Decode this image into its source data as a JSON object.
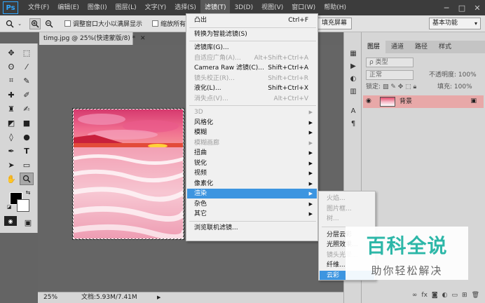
{
  "app": {
    "logo": "Ps"
  },
  "menubar": {
    "items": [
      "文件(F)",
      "编辑(E)",
      "图像(I)",
      "图层(L)",
      "文字(Y)",
      "选择(S)",
      "滤镜(T)",
      "3D(D)",
      "视图(V)",
      "窗口(W)",
      "帮助(H)"
    ],
    "active_index": 6
  },
  "options_bar": {
    "resize_windows_label": "调整窗口大小以满屏显示",
    "zoom_all_label": "缩放所有",
    "fill_screen_label": "填充屏幕",
    "workspace": "基本功能"
  },
  "document": {
    "tab_label": "timg.jpg @ 25%(快速蒙版/8) *",
    "zoom": "25%",
    "doc_info": "文档:5.93M/7.41M"
  },
  "filter_menu": {
    "items": [
      {
        "label": "凸出",
        "shortcut": "Ctrl+F",
        "disabled": false
      },
      {
        "sep": true
      },
      {
        "label": "转换为智能滤镜(S)",
        "disabled": false
      },
      {
        "sep": true
      },
      {
        "label": "滤镜库(G)...",
        "disabled": false
      },
      {
        "label": "自适应广角(A)...",
        "shortcut": "Alt+Shift+Ctrl+A",
        "disabled": true
      },
      {
        "label": "Camera Raw 滤镜(C)...",
        "shortcut": "Shift+Ctrl+A",
        "disabled": false
      },
      {
        "label": "镜头校正(R)...",
        "shortcut": "Shift+Ctrl+R",
        "disabled": true
      },
      {
        "label": "液化(L)...",
        "shortcut": "Shift+Ctrl+X",
        "disabled": false
      },
      {
        "label": "消失点(V)...",
        "shortcut": "Alt+Ctrl+V",
        "disabled": true
      },
      {
        "sep": true
      },
      {
        "label": "3D",
        "submenu": true,
        "disabled": true
      },
      {
        "label": "风格化",
        "submenu": true,
        "disabled": false
      },
      {
        "label": "模糊",
        "submenu": true,
        "disabled": false
      },
      {
        "label": "模糊画廊",
        "submenu": true,
        "disabled": true
      },
      {
        "label": "扭曲",
        "submenu": true,
        "disabled": false
      },
      {
        "label": "锐化",
        "submenu": true,
        "disabled": false
      },
      {
        "label": "视频",
        "submenu": true,
        "disabled": false
      },
      {
        "label": "像素化",
        "submenu": true,
        "disabled": false
      },
      {
        "label": "渲染",
        "submenu": true,
        "disabled": false,
        "highlight": true
      },
      {
        "label": "杂色",
        "submenu": true,
        "disabled": false
      },
      {
        "label": "其它",
        "submenu": true,
        "disabled": false
      },
      {
        "sep": true
      },
      {
        "label": "浏览联机滤镜...",
        "disabled": false
      }
    ]
  },
  "render_submenu": {
    "items": [
      {
        "label": "火焰...",
        "disabled": true
      },
      {
        "label": "图片框...",
        "disabled": true
      },
      {
        "label": "树...",
        "disabled": true
      },
      {
        "sep": true
      },
      {
        "label": "分层云彩",
        "disabled": false
      },
      {
        "label": "光照效果...",
        "disabled": false
      },
      {
        "label": "镜头光晕...",
        "disabled": true
      },
      {
        "label": "纤维...",
        "disabled": false
      },
      {
        "label": "云彩",
        "disabled": false,
        "highlight": true
      }
    ]
  },
  "layers_panel": {
    "tabs": [
      "图层",
      "通道",
      "路径",
      "样式"
    ],
    "filter_kind": "ρ 类型",
    "blend_mode": "正常",
    "opacity_label": "不透明度: 100%",
    "lock_label": "锁定:",
    "fill_label": "填充: 100%",
    "layer_name": "背景"
  },
  "watermark": {
    "title": "百科全说",
    "subtitle": "助你轻松解决"
  },
  "colors": {
    "menu_highlight": "#3d95e0",
    "layer_selected": "#e8a8a8",
    "watermark_green": "#2db7a8"
  }
}
